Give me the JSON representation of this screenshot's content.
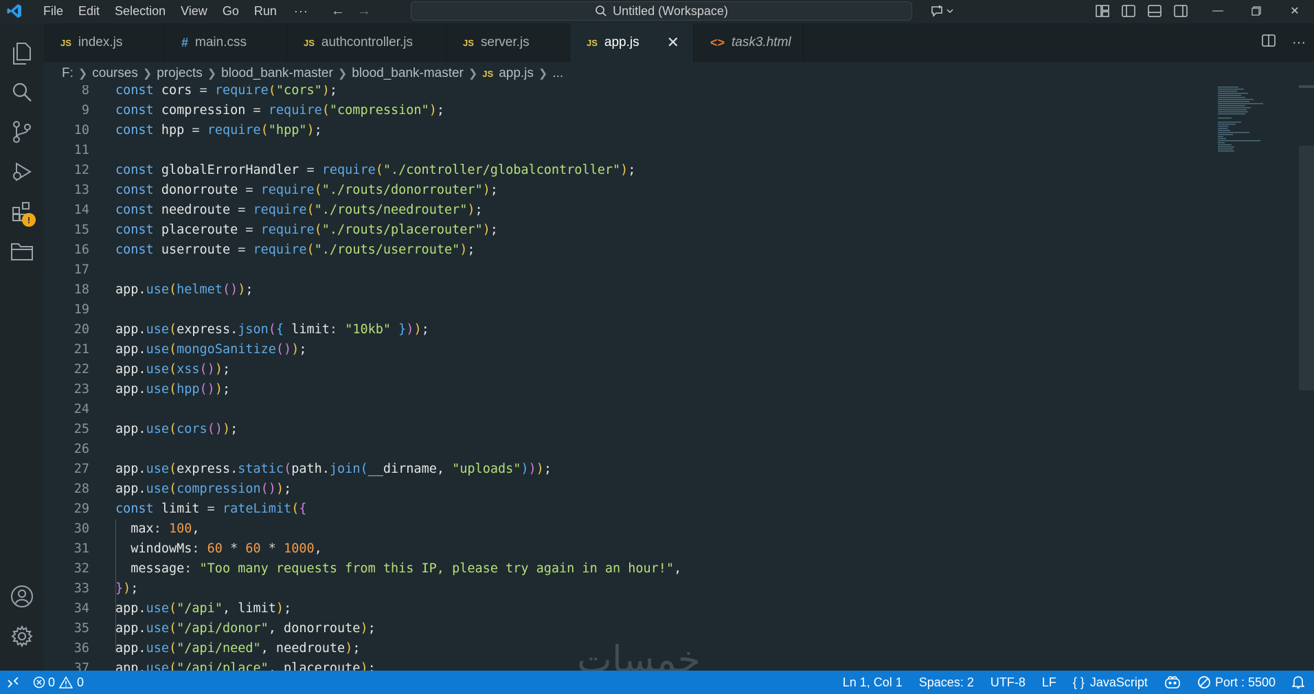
{
  "titlebar": {
    "menu": [
      "File",
      "Edit",
      "Selection",
      "View",
      "Go",
      "Run"
    ],
    "more": "···",
    "search_text": "Untitled (Workspace)"
  },
  "tabs": [
    {
      "label": "index.js",
      "icon": "JS",
      "type": "js",
      "active": false,
      "italic": false
    },
    {
      "label": "main.css",
      "icon": "#",
      "type": "css",
      "active": false,
      "italic": false
    },
    {
      "label": "authcontroller.js",
      "icon": "JS",
      "type": "js",
      "active": false,
      "italic": false
    },
    {
      "label": "server.js",
      "icon": "JS",
      "type": "js",
      "active": false,
      "italic": false
    },
    {
      "label": "app.js",
      "icon": "JS",
      "type": "js",
      "active": true,
      "italic": false
    },
    {
      "label": "task3.html",
      "icon": "<>",
      "type": "html",
      "active": false,
      "italic": true
    }
  ],
  "breadcrumbs": [
    "F:",
    "courses",
    "projects",
    "blood_bank-master",
    "blood_bank-master"
  ],
  "breadcrumb_file": "app.js",
  "breadcrumb_icon": "JS",
  "breadcrumb_tail": "...",
  "code": {
    "line_numbers": [
      "8",
      "9",
      "10",
      "11",
      "12",
      "13",
      "14",
      "15",
      "16",
      "17",
      "18",
      "19",
      "20",
      "21",
      "22",
      "23",
      "24",
      "25",
      "26",
      "27",
      "28",
      "29",
      "30",
      "31",
      "32",
      "33",
      "34",
      "35",
      "36",
      "37"
    ]
  },
  "watermark": "خمسات",
  "statusbar": {
    "errors": "0",
    "warnings": "0",
    "position": "Ln 1, Col 1",
    "spaces": "Spaces: 2",
    "encoding": "UTF-8",
    "eol": "LF",
    "language_braces": "{ }",
    "language": "JavaScript",
    "port": "Port : 5500"
  },
  "colors": {
    "statusbar": "#0e7ad3",
    "editor_bg": "#1e2a2f",
    "keyword": "#6cb0f0",
    "string": "#b7e07a",
    "number": "#f39c4a"
  }
}
